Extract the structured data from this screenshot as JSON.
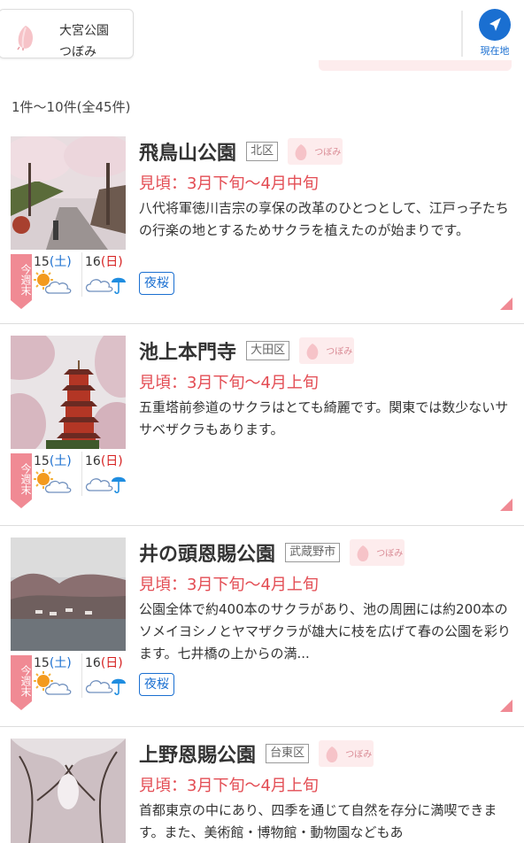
{
  "header": {
    "location_name": "大宮公園",
    "location_status": "つぼみ",
    "locate_label": "現在地"
  },
  "result_count": "1件〜10件(全45件)",
  "weekend_label": "今週末",
  "day1": {
    "num": "15",
    "paren_open": "(",
    "weekday": "土",
    "paren_close": ")",
    "weather": "sunny-then-cloudy"
  },
  "day2": {
    "num": "16",
    "paren_open": "(",
    "weekday": "日",
    "paren_close": ")",
    "weather": "cloudy-then-rain"
  },
  "bloom_status": "つぼみ",
  "spots": [
    {
      "name": "飛鳥山公園",
      "ward": "北区",
      "peak": "見頃：3月下旬〜4月中旬",
      "description": "八代将軍徳川吉宗の享保の改革のひとつとして、江戸っ子たちの行楽の地とするためサクラを植えたのが始まりです。",
      "tag": "夜桜"
    },
    {
      "name": "池上本門寺",
      "ward": "大田区",
      "peak": "見頃：3月下旬〜4月上旬",
      "description": "五重塔前参道のサクラはとても綺麗です。関東では数少ないササベザクラもあります。"
    },
    {
      "name": "井の頭恩賜公園",
      "ward": "武蔵野市",
      "peak": "見頃：3月下旬〜4月上旬",
      "description": "公園全体で約400本のサクラがあり、池の周囲には約200本のソメイヨシノとヤマザクラが雄大に枝を広げて春の公園を彩ります。七井橋の上からの満...",
      "tag": "夜桜"
    },
    {
      "name": "上野恩賜公園",
      "ward": "台東区",
      "peak": "見頃：3月下旬〜4月上旬",
      "description": "首都東京の中にあり、四季を通じて自然を存分に満喫できます。また、美術館・博物館・動物園などもあ"
    }
  ],
  "colors": {
    "accent_blue": "#1a6fd1",
    "peak_red": "#e34d54",
    "weekend_pink": "#f08a94"
  }
}
